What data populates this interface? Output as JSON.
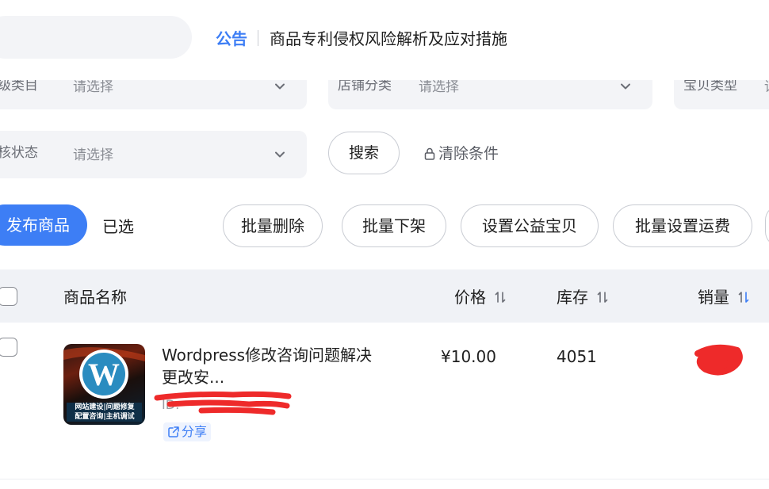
{
  "notice": {
    "tag": "公告",
    "text": "商品专利侵权风险解析及应对措施"
  },
  "filters": {
    "category": {
      "label": "一级类目",
      "placeholder": "请选择"
    },
    "shop_category": {
      "label": "店铺分类",
      "placeholder": "请选择"
    },
    "item_type": {
      "label": "宝贝类型",
      "placeholder": "请"
    },
    "review_status": {
      "label": "审核状态",
      "placeholder": "请选择"
    },
    "search_label": "搜索",
    "clear_label": "清除条件"
  },
  "actions": {
    "publish_label": "发布商品",
    "selected_label": "已选",
    "bulk": [
      "批量删除",
      "批量下架",
      "设置公益宝贝",
      "批量设置运费"
    ]
  },
  "table": {
    "columns": {
      "name": "商品名称",
      "price": "价格",
      "stock": "库存",
      "sales": "销量"
    },
    "rows": [
      {
        "name": "Wordpress修改咨询问题解决更改安...",
        "id_label": "ID:",
        "share_label": "分享",
        "price": "¥10.00",
        "stock": "4051",
        "thumb_text": [
          "网站建设|问题修复",
          "配置咨询|主机调试"
        ]
      }
    ]
  },
  "colors": {
    "accent": "#3d7ef5",
    "filter_bg": "#f3f4f7",
    "header_bg": "#f0f2f6",
    "redaction": "#ee2a2a"
  },
  "icons": [
    "chevron-down-icon",
    "sort-icon",
    "sort-active-icon",
    "lock-icon",
    "share-icon",
    "wordpress-logo-icon"
  ]
}
